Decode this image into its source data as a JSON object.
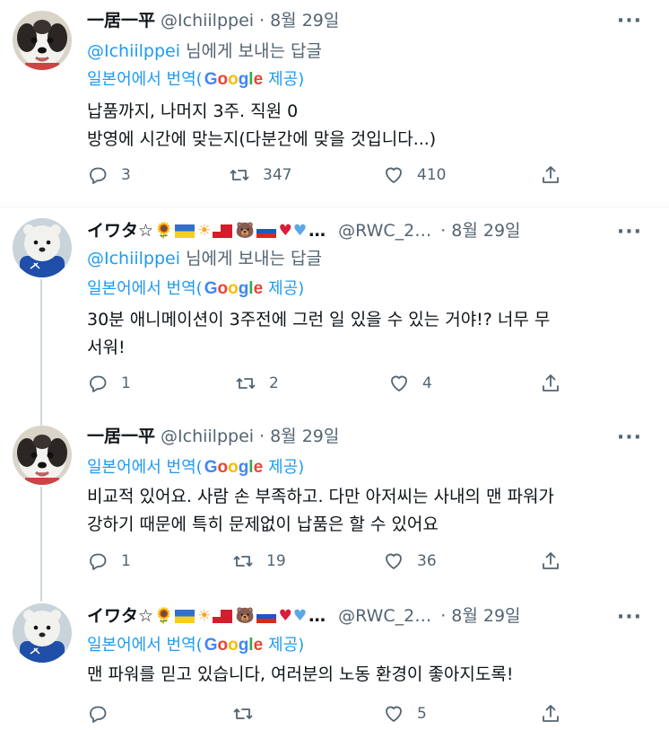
{
  "tweets": [
    {
      "name": "一居一平",
      "emojis": "",
      "handle": "@Ichiilppei",
      "dot": "·",
      "date": "8월 29일",
      "more": "···",
      "reply_prefix": "",
      "reply_mention": "@Ichiilppei",
      "reply_suffix": " 님에게 보내는 답글",
      "translate_label": "일본어에서 번역",
      "translate_open": "(",
      "translate_provider": "Google",
      "translate_close": " 제공)",
      "text": "납품까지, 나머지 3주. 직원 0\n방영에 시간에 맞는지(다분간에 맞을 것입니다...)",
      "replies": "3",
      "retweets": "347",
      "likes": "410"
    },
    {
      "name": "イワタ☆",
      "emojis": "…",
      "handle": "@RWC_2…",
      "dot": "·",
      "date": "8월 29일",
      "more": "···",
      "reply_mention": "@Ichiilppei",
      "reply_suffix": " 님에게 보내는 답글",
      "translate_label": "일본어에서 번역",
      "translate_open": "(",
      "translate_provider": "Google",
      "translate_close": " 제공)",
      "text": "30분 애니메이션이 3주전에 그런 일 있을 수 있는 거야!? 너무 무\n서워!",
      "replies": "1",
      "retweets": "2",
      "likes": "4"
    },
    {
      "name": "一居一平",
      "handle": "@Ichiilppei",
      "dot": "·",
      "date": "8월 29일",
      "more": "···",
      "translate_label": "일본어에서 번역",
      "translate_open": "(",
      "translate_provider": "Google",
      "translate_close": " 제공)",
      "text": "비교적 있어요. 사람 손 부족하고. 다만 아저씨는 사내의 맨 파워가\n강하기 때문에 특히 문제없이 납품은 할 수 있어요",
      "replies": "1",
      "retweets": "19",
      "likes": "36"
    },
    {
      "name": "イワタ☆",
      "emojis": "…",
      "handle": "@RWC_2…",
      "dot": "·",
      "date": "8월 29일",
      "more": "···",
      "translate_label": "일본어에서 번역",
      "translate_open": "(",
      "translate_provider": "Google",
      "translate_close": " 제공)",
      "text": "맨 파워를 믿고 있습니다, 여러분의 노동 환경이 좋아지도록!",
      "replies": "",
      "retweets": "",
      "likes": "5"
    }
  ],
  "colors": {
    "accent": "#1d9bf0",
    "muted": "#536471",
    "text": "#0f1419",
    "heart": "#e0245e"
  },
  "icons": {
    "reply": "reply-icon",
    "retweet": "retweet-icon",
    "like": "heart-icon",
    "share": "share-icon"
  }
}
